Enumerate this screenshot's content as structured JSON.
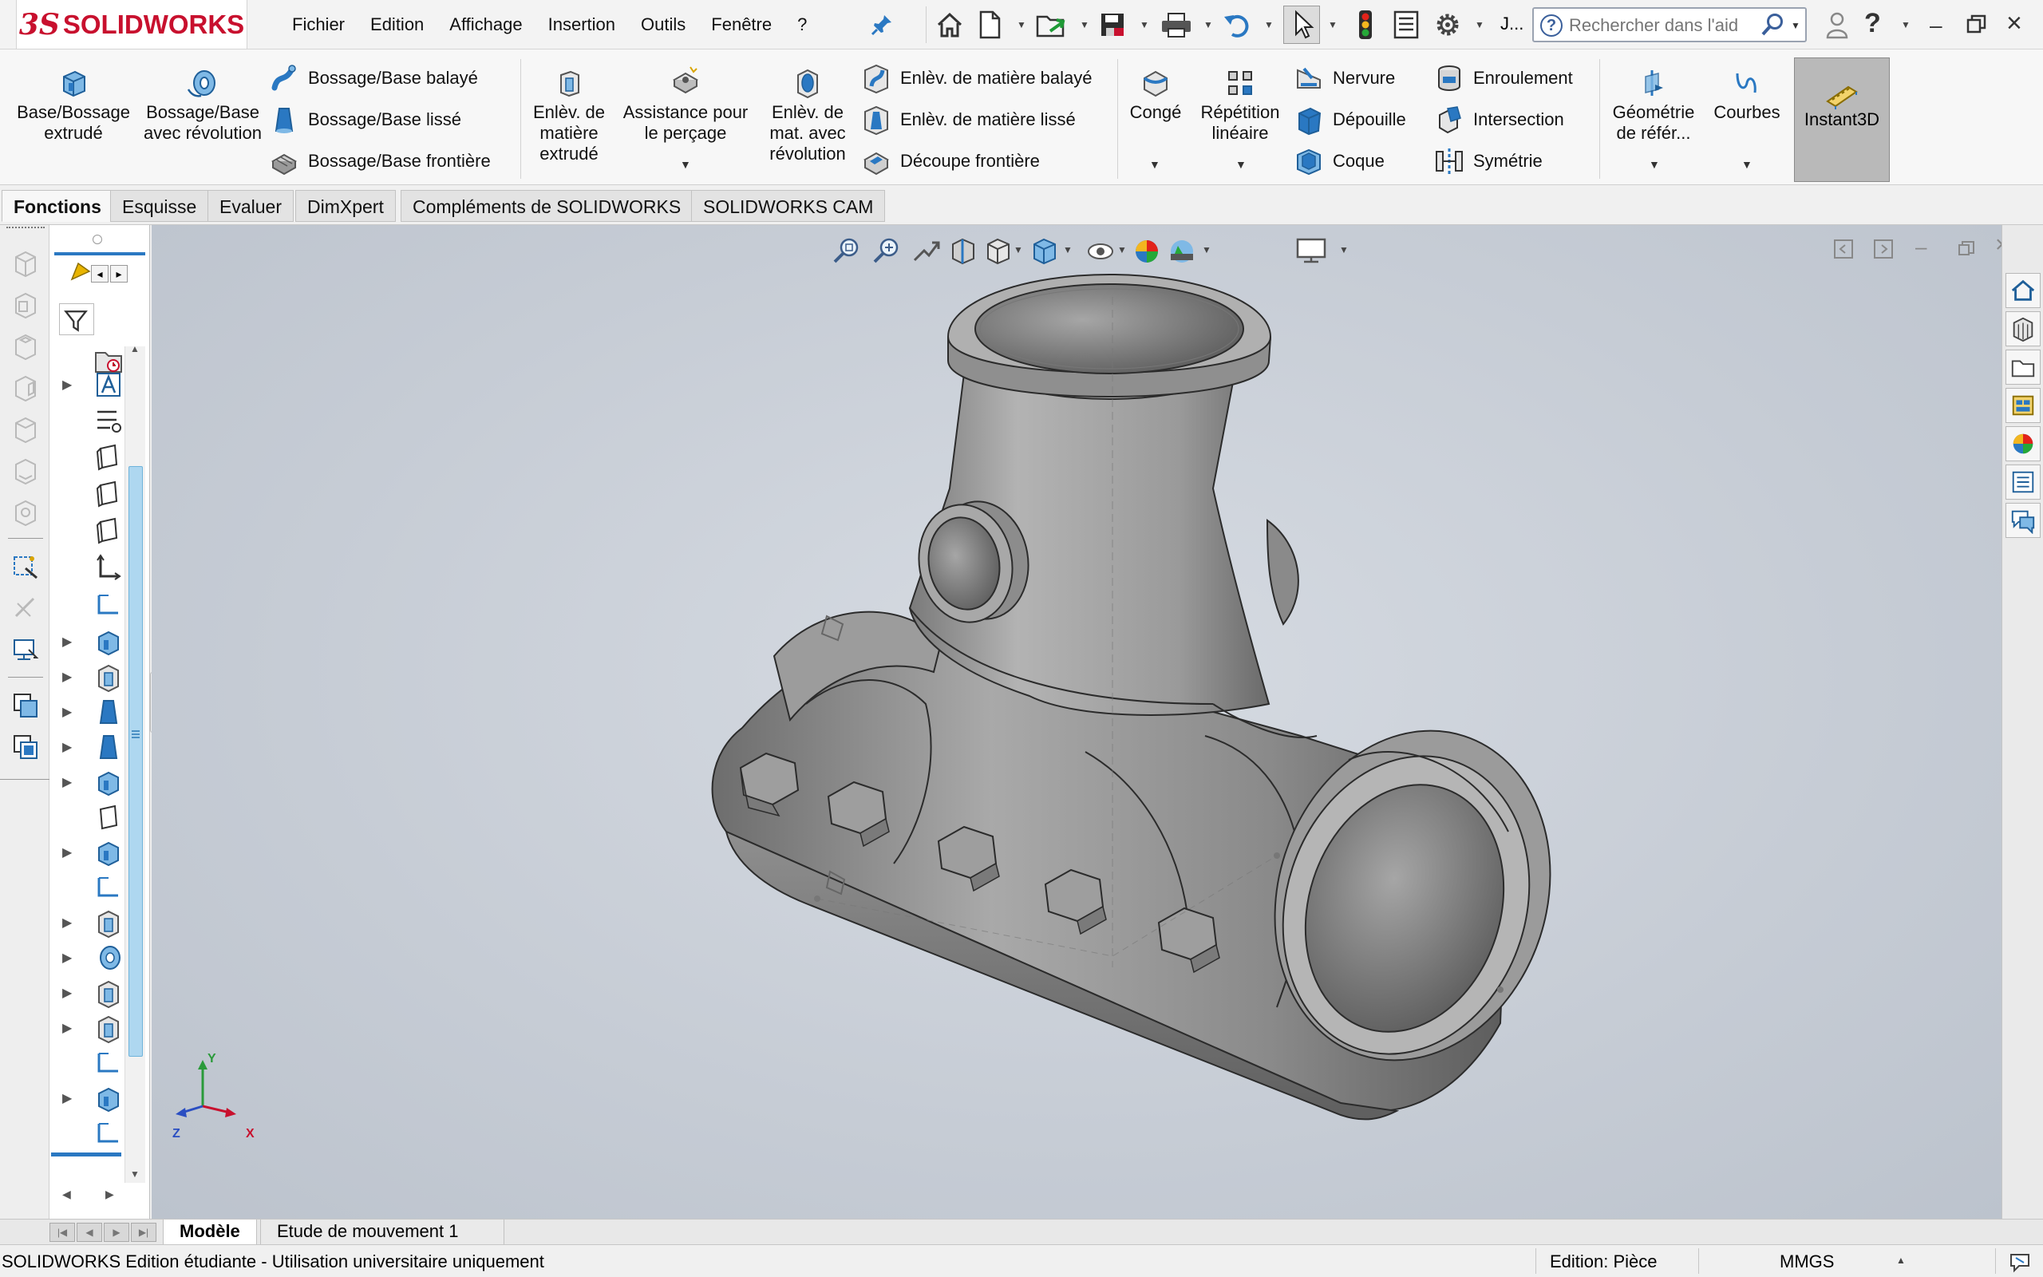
{
  "app": {
    "logo_prefix": "3S",
    "logo_brand": "SOLIDWORKS"
  },
  "menu": {
    "items": [
      "Fichier",
      "Edition",
      "Affichage",
      "Insertion",
      "Outils",
      "Fenêtre",
      "?"
    ]
  },
  "toolbar": {
    "user_label": "J...",
    "search_placeholder": "Rechercher dans l'aid"
  },
  "ribbon": {
    "extruded_boss": "Base/Bossage extrudé",
    "revolved_boss": "Bossage/Base avec révolution",
    "swept_boss": "Bossage/Base balayé",
    "lofted_boss": "Bossage/Base lissé",
    "boundary_boss": "Bossage/Base frontière",
    "extruded_cut": "Enlèv. de matière extrudé",
    "hole_wizard": "Assistance pour le perçage",
    "revolved_cut": "Enlèv. de mat. avec révolution",
    "swept_cut": "Enlèv. de matière balayé",
    "lofted_cut": "Enlèv. de matière lissé",
    "boundary_cut": "Découpe frontière",
    "fillet": "Congé",
    "linear_pattern": "Répétition linéaire",
    "rib": "Nervure",
    "draft": "Dépouille",
    "shell": "Coque",
    "wrap": "Enroulement",
    "intersect": "Intersection",
    "mirror": "Symétrie",
    "ref_geometry": "Géométrie de référ...",
    "curves": "Courbes",
    "instant3d": "Instant3D"
  },
  "tabs": [
    "Fonctions",
    "Esquisse",
    "Evaluer",
    "DimXpert",
    "Compléments de SOLIDWORKS",
    "SOLIDWORKS CAM"
  ],
  "triad": {
    "y": "Y",
    "x": "X",
    "z": "Z"
  },
  "bottom_tabs": [
    "Modèle",
    "Etude de mouvement 1"
  ],
  "status": {
    "left": "SOLIDWORKS Edition étudiante - Utilisation universitaire uniquement",
    "mode": "Edition: Pièce",
    "units": "MMGS"
  },
  "colors": {
    "brand_red": "#c8102e",
    "viewport_bg": "#c6ccd5",
    "part_gray": "#8e8e8e",
    "accent_blue": "#2a78c2"
  }
}
